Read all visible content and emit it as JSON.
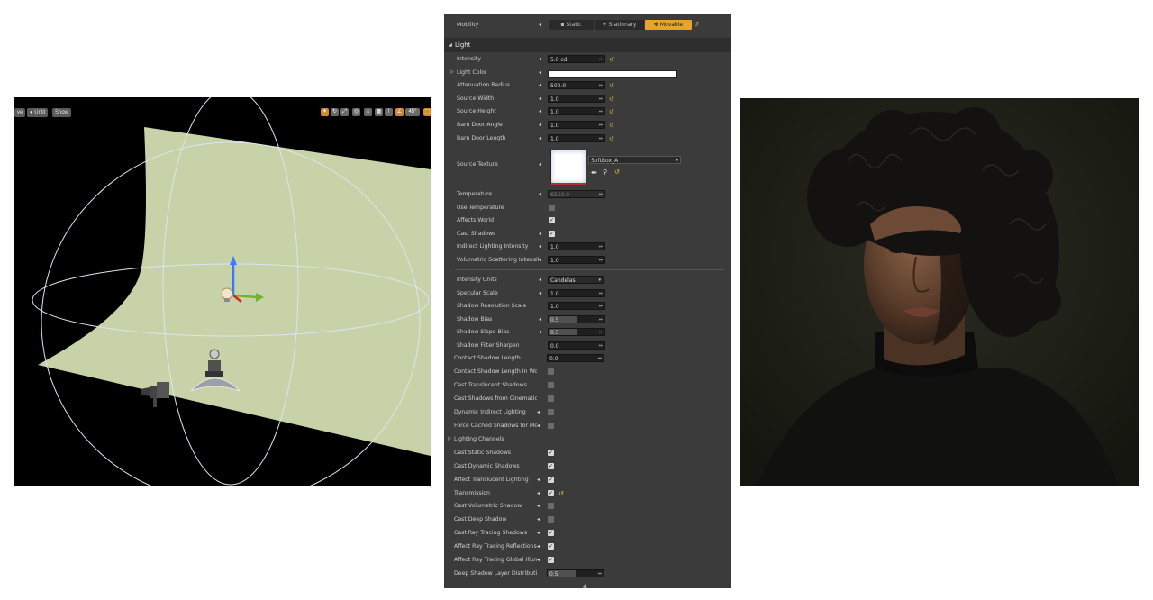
{
  "viewport": {
    "buttons": {
      "prev": "ve",
      "unlit": "Unlit",
      "show": "Show"
    },
    "toolbar_icons": [
      "grid-icon",
      "rotate-icon",
      "scale-icon",
      "camera-icon",
      "snap-icon",
      "grid-snap-icon",
      "warning-icon",
      "angle-icon",
      "orange-icon"
    ],
    "angle_label": "45°",
    "colors": {
      "backdrop": "#c8d2a8",
      "gizmo_z": "#3a78ff",
      "gizmo_y": "#6fb52e",
      "gizmo_x": "#d4281e",
      "helper_lines": "#d9e6f0"
    }
  },
  "details": {
    "mobility": {
      "label": "Mobility",
      "options": [
        "Static",
        "Stationary",
        "Movable"
      ],
      "selected": "Movable"
    },
    "light_section": "Light",
    "rows": [
      {
        "label": "Intensity",
        "value": "5.0 cd",
        "type": "num",
        "reset": true,
        "ovr": true
      },
      {
        "label": "Light Color",
        "type": "color",
        "expand": true,
        "ovr": true
      },
      {
        "label": "Attenuation Radius",
        "value": "500.0",
        "type": "num",
        "reset": true,
        "ovr": true
      },
      {
        "label": "Source Width",
        "value": "1.0",
        "type": "num",
        "reset": true,
        "ovr": true
      },
      {
        "label": "Source Height",
        "value": "1.0",
        "type": "num",
        "reset": true,
        "ovr": true
      },
      {
        "label": "Barn Door Angle",
        "value": "1.0",
        "type": "num",
        "reset": true,
        "ovr": true
      },
      {
        "label": "Barn Door Length",
        "value": "1.0",
        "type": "num",
        "reset": true,
        "ovr": true
      }
    ],
    "source_texture": {
      "label": "Source Texture",
      "asset": "SoftBox_A"
    },
    "rows2": [
      {
        "label": "Temperature",
        "value": "6500.0",
        "type": "numdim",
        "ovr": true
      },
      {
        "label": "Use Temperature",
        "type": "chk",
        "checked": false
      },
      {
        "label": "Affects World",
        "type": "chk",
        "checked": true
      },
      {
        "label": "Cast Shadows",
        "type": "chk",
        "checked": true,
        "ovr": true
      },
      {
        "label": "Indirect Lighting Intensity",
        "value": "1.0",
        "type": "numw",
        "ovr": true
      },
      {
        "label": "Volumetric Scattering Intensity",
        "value": "1.0",
        "type": "numw",
        "ovr": true
      }
    ],
    "rows3": [
      {
        "label": "Intensity Units",
        "value": "Candelas",
        "type": "select",
        "ovr": true
      },
      {
        "label": "Specular Scale",
        "value": "1.0",
        "type": "num",
        "ovr": true
      },
      {
        "label": "Shadow Resolution Scale",
        "value": "1.0",
        "type": "num"
      },
      {
        "label": "Shadow Bias",
        "value": "0.5",
        "type": "slider",
        "ovr": true
      },
      {
        "label": "Shadow Slope Bias",
        "value": "0.5",
        "type": "slider",
        "ovr": true
      },
      {
        "label": "Shadow Filter Sharpen",
        "value": "0.0",
        "type": "num"
      }
    ],
    "rows4": [
      {
        "label": "Contact Shadow Length",
        "value": "0.0",
        "type": "numw"
      },
      {
        "label": "Contact Shadow Length In World Space Units",
        "type": "chk",
        "checked": false
      },
      {
        "label": "Cast Translucent Shadows",
        "type": "chk",
        "checked": false
      },
      {
        "label": "Cast Shadows from Cinematic Objects Only",
        "type": "chk",
        "checked": false
      },
      {
        "label": "Dynamic Indirect Lighting",
        "type": "chk",
        "checked": false,
        "ovr": true
      },
      {
        "label": "Force Cached Shadows for Movable Primitives",
        "type": "chk",
        "checked": false,
        "ovr": true
      },
      {
        "label": "Lighting Channels",
        "type": "none",
        "expand": true
      },
      {
        "label": "Cast Static Shadows",
        "type": "chk",
        "checked": true
      },
      {
        "label": "Cast Dynamic Shadows",
        "type": "chk",
        "checked": true
      },
      {
        "label": "Affect Translucent Lighting",
        "type": "chk",
        "checked": true,
        "ovr": true
      },
      {
        "label": "Transmission",
        "type": "chk",
        "checked": true,
        "ovr": true,
        "reset": true
      },
      {
        "label": "Cast Volumetric Shadow",
        "type": "chk",
        "checked": false,
        "ovr": true
      },
      {
        "label": "Cast Deep Shadow",
        "type": "chk",
        "checked": false,
        "ovr": true
      },
      {
        "label": "Cast Ray Tracing Shadows",
        "type": "chk",
        "checked": true,
        "ovr": true
      },
      {
        "label": "Affect Ray Tracing Reflections",
        "type": "chk",
        "checked": true,
        "ovr": true
      },
      {
        "label": "Affect Ray Tracing Global Illumination",
        "type": "chk",
        "checked": true,
        "ovr": true
      },
      {
        "label": "Deep Shadow Layer Distribution",
        "value": "0.5",
        "type": "slider"
      }
    ],
    "colors": {
      "panel": "#3b3b3b",
      "accent": "#e6a52a",
      "reset": "#e8c23a",
      "light_color": "#ffffff"
    }
  },
  "portrait": {
    "colors": {
      "background": "#1c1e16",
      "skin": "#6b4a35",
      "hair": "#15130f",
      "sweater": "#101010"
    }
  }
}
